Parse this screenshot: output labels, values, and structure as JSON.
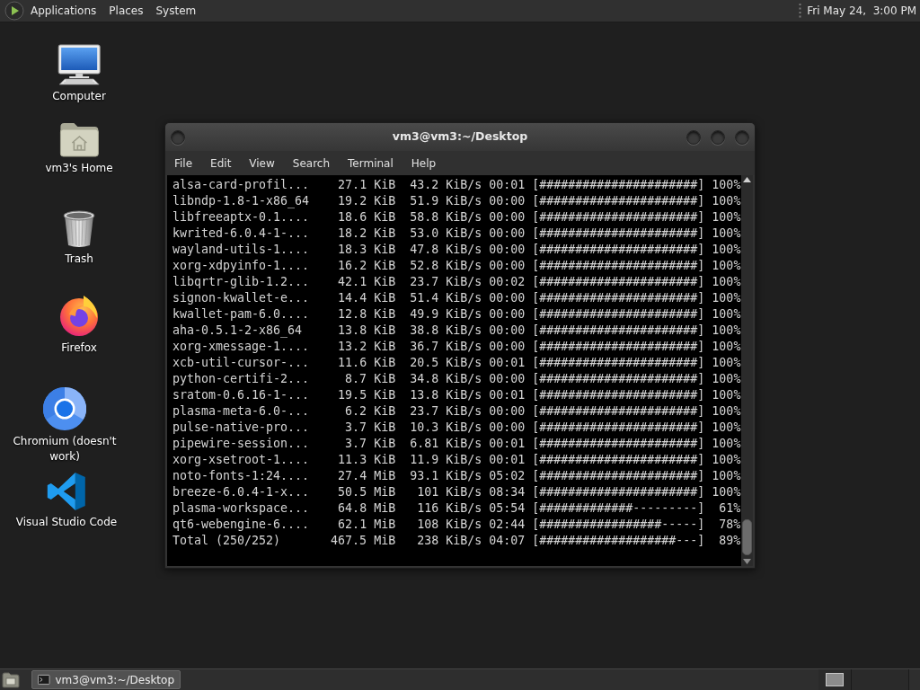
{
  "top_panel": {
    "menus": [
      "Applications",
      "Places",
      "System"
    ],
    "clock": "Fri May 24,  3:00 PM"
  },
  "desktop_icons": [
    {
      "kind": "computer",
      "label": "Computer"
    },
    {
      "kind": "home",
      "label": "vm3's Home"
    },
    {
      "kind": "trash",
      "label": "Trash"
    },
    {
      "kind": "firefox",
      "label": "Firefox"
    },
    {
      "kind": "chromium",
      "label": "Chromium (doesn't work)"
    },
    {
      "kind": "vscode",
      "label": "Visual Studio Code"
    }
  ],
  "terminal": {
    "title": "vm3@vm3:~/Desktop",
    "menu": [
      "File",
      "Edit",
      "View",
      "Search",
      "Terminal",
      "Help"
    ],
    "rows": [
      {
        "name": "alsa-card-profil...",
        "size": "27.1 KiB",
        "rate": "43.2 KiB/s",
        "eta": "00:01",
        "bar": "[######################]",
        "percent": "100%"
      },
      {
        "name": "libndp-1.8-1-x86_64",
        "size": "19.2 KiB",
        "rate": "51.9 KiB/s",
        "eta": "00:00",
        "bar": "[######################]",
        "percent": "100%"
      },
      {
        "name": "libfreeaptx-0.1....",
        "size": "18.6 KiB",
        "rate": "58.8 KiB/s",
        "eta": "00:00",
        "bar": "[######################]",
        "percent": "100%"
      },
      {
        "name": "kwrited-6.0.4-1-...",
        "size": "18.2 KiB",
        "rate": "53.0 KiB/s",
        "eta": "00:00",
        "bar": "[######################]",
        "percent": "100%"
      },
      {
        "name": "wayland-utils-1....",
        "size": "18.3 KiB",
        "rate": "47.8 KiB/s",
        "eta": "00:00",
        "bar": "[######################]",
        "percent": "100%"
      },
      {
        "name": "xorg-xdpyinfo-1....",
        "size": "16.2 KiB",
        "rate": "52.8 KiB/s",
        "eta": "00:00",
        "bar": "[######################]",
        "percent": "100%"
      },
      {
        "name": "libqrtr-glib-1.2...",
        "size": "42.1 KiB",
        "rate": "23.7 KiB/s",
        "eta": "00:02",
        "bar": "[######################]",
        "percent": "100%"
      },
      {
        "name": "signon-kwallet-e...",
        "size": "14.4 KiB",
        "rate": "51.4 KiB/s",
        "eta": "00:00",
        "bar": "[######################]",
        "percent": "100%"
      },
      {
        "name": "kwallet-pam-6.0....",
        "size": "12.8 KiB",
        "rate": "49.9 KiB/s",
        "eta": "00:00",
        "bar": "[######################]",
        "percent": "100%"
      },
      {
        "name": "aha-0.5.1-2-x86_64",
        "size": "13.8 KiB",
        "rate": "38.8 KiB/s",
        "eta": "00:00",
        "bar": "[######################]",
        "percent": "100%"
      },
      {
        "name": "xorg-xmessage-1....",
        "size": "13.2 KiB",
        "rate": "36.7 KiB/s",
        "eta": "00:00",
        "bar": "[######################]",
        "percent": "100%"
      },
      {
        "name": "xcb-util-cursor-...",
        "size": "11.6 KiB",
        "rate": "20.5 KiB/s",
        "eta": "00:01",
        "bar": "[######################]",
        "percent": "100%"
      },
      {
        "name": "python-certifi-2...",
        "size": "8.7 KiB",
        "rate": "34.8 KiB/s",
        "eta": "00:00",
        "bar": "[######################]",
        "percent": "100%"
      },
      {
        "name": "sratom-0.6.16-1-...",
        "size": "19.5 KiB",
        "rate": "13.8 KiB/s",
        "eta": "00:01",
        "bar": "[######################]",
        "percent": "100%"
      },
      {
        "name": "plasma-meta-6.0-...",
        "size": "6.2 KiB",
        "rate": "23.7 KiB/s",
        "eta": "00:00",
        "bar": "[######################]",
        "percent": "100%"
      },
      {
        "name": "pulse-native-pro...",
        "size": "3.7 KiB",
        "rate": "10.3 KiB/s",
        "eta": "00:00",
        "bar": "[######################]",
        "percent": "100%"
      },
      {
        "name": "pipewire-session...",
        "size": "3.7 KiB",
        "rate": "6.81 KiB/s",
        "eta": "00:01",
        "bar": "[######################]",
        "percent": "100%"
      },
      {
        "name": "xorg-xsetroot-1....",
        "size": "11.3 KiB",
        "rate": "11.9 KiB/s",
        "eta": "00:01",
        "bar": "[######################]",
        "percent": "100%"
      },
      {
        "name": "noto-fonts-1:24....",
        "size": "27.4 MiB",
        "rate": "93.1 KiB/s",
        "eta": "05:02",
        "bar": "[######################]",
        "percent": "100%"
      },
      {
        "name": "breeze-6.0.4-1-x...",
        "size": "50.5 MiB",
        "rate": "101 KiB/s",
        "eta": "08:34",
        "bar": "[######################]",
        "percent": "100%"
      },
      {
        "name": "plasma-workspace...",
        "size": "64.8 MiB",
        "rate": "116 KiB/s",
        "eta": "05:54",
        "bar": "[#############---------]",
        "percent": "61%"
      },
      {
        "name": "qt6-webengine-6....",
        "size": "62.1 MiB",
        "rate": "108 KiB/s",
        "eta": "02:44",
        "bar": "[#################-----]",
        "percent": "78%"
      }
    ],
    "total": {
      "label": "Total (250/252)",
      "size": "467.5 MiB",
      "rate": "238 KiB/s",
      "eta": "04:07",
      "bar": "[###################---]",
      "percent": "89%"
    }
  },
  "taskbar": {
    "tasks": [
      {
        "title": "vm3@vm3:~/Desktop",
        "selected": true
      }
    ]
  }
}
